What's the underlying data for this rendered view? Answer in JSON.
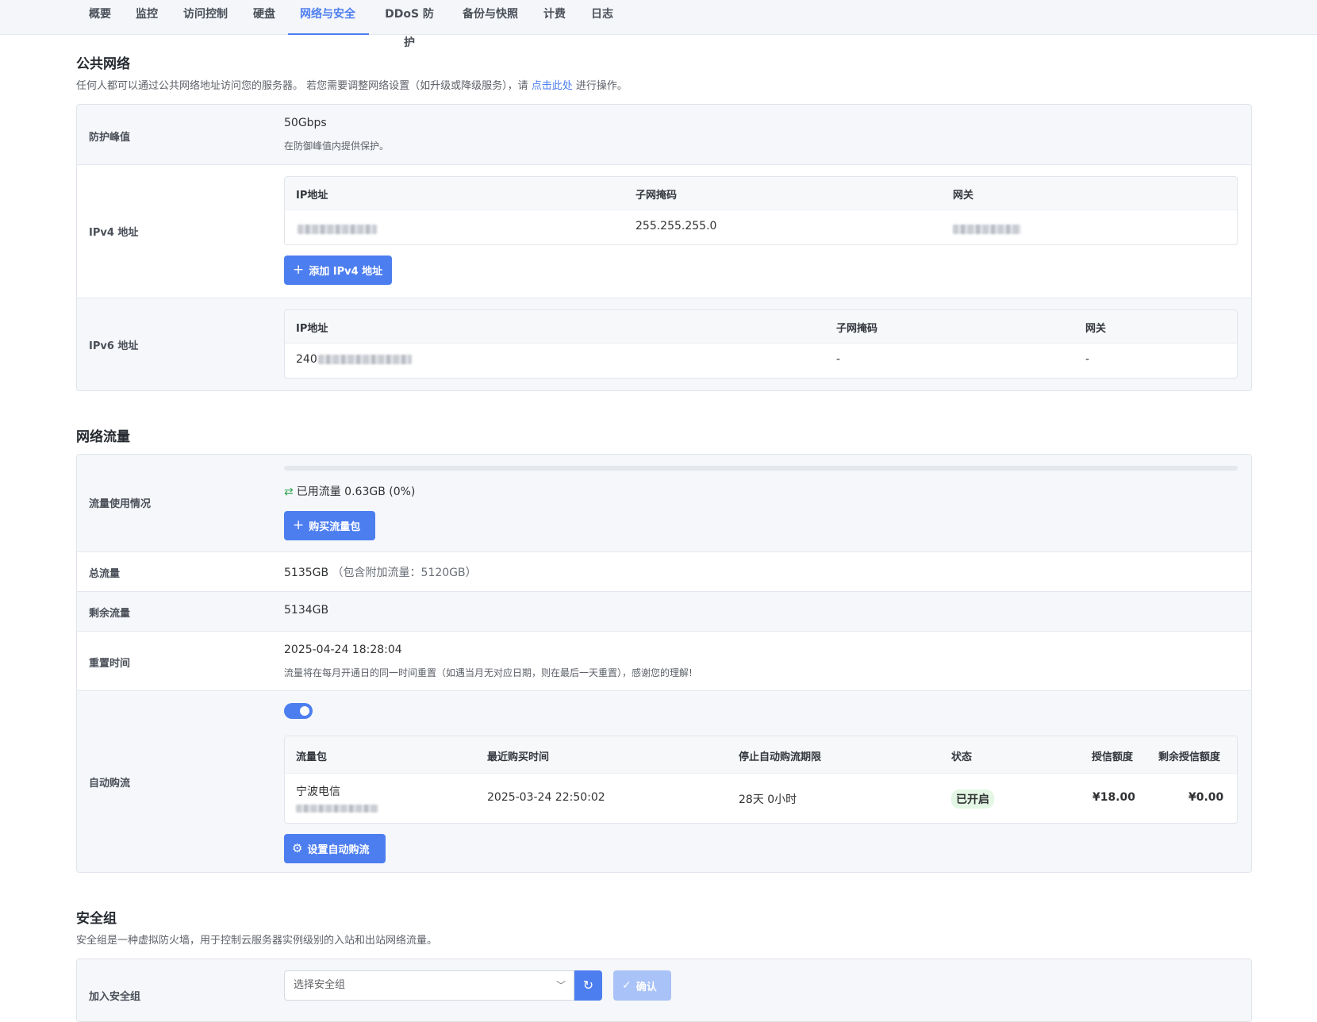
{
  "tabs": [
    {
      "label": "概要"
    },
    {
      "label": "监控"
    },
    {
      "label": "访问控制"
    },
    {
      "label": "硬盘"
    },
    {
      "label": "网络与安全"
    },
    {
      "label": "DDoS 防护"
    },
    {
      "label": "备份与快照"
    },
    {
      "label": "计费"
    },
    {
      "label": "日志"
    }
  ],
  "public_network": {
    "title": "公共网络",
    "desc_prefix": "任何人都可以通过公共网络地址访问您的服务器。 若您需要调整网络设置（如升级或降级服务），请 ",
    "desc_link": "点击此处",
    "desc_suffix": " 进行操作。",
    "protection": {
      "label": "防护峰值",
      "value": "50Gbps",
      "note": "在防御峰值内提供保护。"
    },
    "ipv4": {
      "label": "IPv4 地址",
      "headers": [
        "IP地址",
        "子网掩码",
        "网关"
      ],
      "subnet": "255.255.255.0",
      "add_button": "添加 IPv4 地址"
    },
    "ipv6": {
      "label": "IPv6 地址",
      "headers": [
        "IP地址",
        "子网掩码",
        "网关"
      ],
      "ip_prefix": "240",
      "subnet": "-",
      "gateway": "-"
    }
  },
  "traffic": {
    "title": "网络流量",
    "usage": {
      "label": "流量使用情况",
      "used_text": "已用流量 0.63GB (0%)",
      "percent": 0,
      "buy_button": "购买流量包"
    },
    "total": {
      "label": "总流量",
      "value": "5135GB",
      "extra": "（包含附加流量：5120GB）"
    },
    "remaining": {
      "label": "剩余流量",
      "value": "5134GB"
    },
    "reset": {
      "label": "重置时间",
      "value": "2025-04-24 18:28:04",
      "note": "流量将在每月开通日的同一时间重置（如遇当月无对应日期，则在最后一天重置），感谢您的理解!"
    },
    "auto": {
      "label": "自动购流",
      "enabled": true,
      "headers": [
        "流量包",
        "最近购买时间",
        "停止自动购流期限",
        "状态",
        "授信额度",
        "剩余授信额度"
      ],
      "row": {
        "package": "宁波电信",
        "last_purchase": "2025-03-24 22:50:02",
        "stop_after": "28天 0小时",
        "status": "已开启",
        "credit": "¥18.00",
        "remaining_credit": "¥0.00"
      },
      "settings_button": "设置自动购流"
    }
  },
  "security_group": {
    "title": "安全组",
    "desc": "安全组是一种虚拟防火墙，用于控制云服务器实例级别的入站和出站网络流量。",
    "join_label": "加入安全组",
    "select_placeholder": "选择安全组",
    "confirm_button": "确认"
  },
  "colors": {
    "accent": "#4d7ef0",
    "status_on": "#2e9a48"
  }
}
